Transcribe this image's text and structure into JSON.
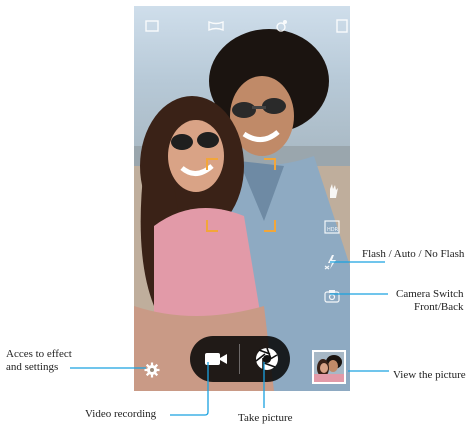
{
  "screen": {
    "top_icons": [
      "photo-icon",
      "panorama-icon",
      "tone-icon",
      "gallery-icon"
    ],
    "side_icons": [
      "scene-hand-icon",
      "hdr-icon",
      "flash-icon",
      "camera-switch-icon"
    ],
    "controls": {
      "video_icon": "video-camera-icon",
      "shutter_icon": "aperture-icon",
      "settings_icon": "gear-icon"
    }
  },
  "annotations": {
    "flash": "Flash / Auto / No Flash",
    "camera_switch_line1": "Camera Switch",
    "camera_switch_line2": "Front/Back",
    "view_picture": "View the picture",
    "effects_line1": "Acces to effect",
    "effects_line2": "and settings",
    "video_recording": "Video recording",
    "take_picture": "Take picture"
  },
  "colors": {
    "callout_line": "#1aa2e0",
    "focus_frame": "#f2a63a",
    "pill_bg": "#080808"
  }
}
